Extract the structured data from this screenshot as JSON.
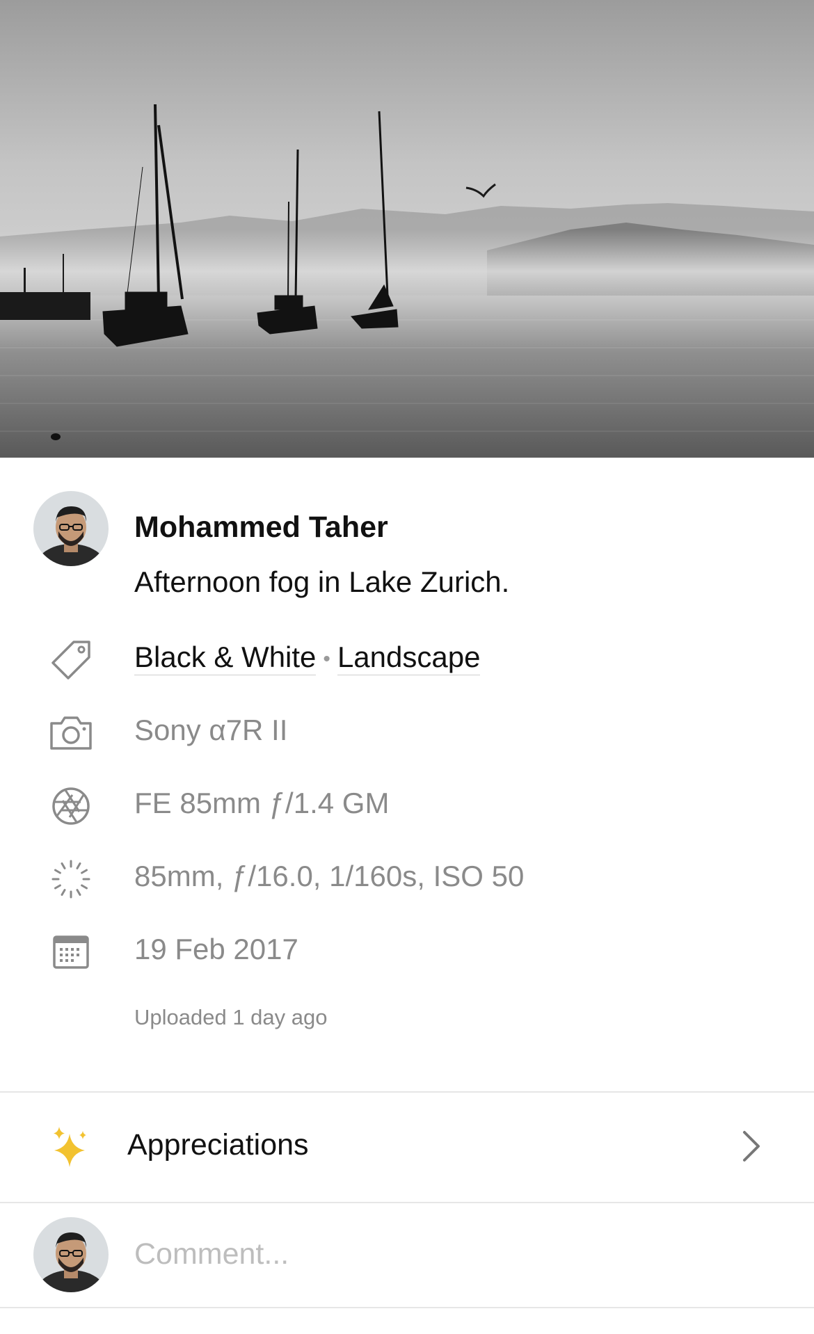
{
  "photo": {
    "subject": "sailboats-on-lake-icon",
    "colors": {
      "sky": "#a7a7a7",
      "water": "#6e6e6e",
      "silhouette": "#111111"
    }
  },
  "post": {
    "author_name": "Mohammed Taher",
    "caption": "Afternoon fog in Lake Zurich.",
    "tags": [
      "Black & White",
      "Landscape"
    ],
    "tag_separator": "•",
    "camera": "Sony α7R II",
    "lens": "FE 85mm ƒ/1.4 GM",
    "exposure": "85mm, ƒ/16.0, 1/160s, ISO 50",
    "date_taken": "19 Feb 2017",
    "uploaded": "Uploaded 1 day ago"
  },
  "icons": {
    "tag": "tag-icon",
    "camera": "camera-icon",
    "lens": "aperture-icon",
    "exposure": "exposure-dial-icon",
    "date": "calendar-icon",
    "appreciations": "sparkles-icon",
    "chevron": "chevron-right-icon"
  },
  "appreciations": {
    "label": "Appreciations",
    "accent": "#f2c230"
  },
  "comment": {
    "placeholder": "Comment..."
  }
}
